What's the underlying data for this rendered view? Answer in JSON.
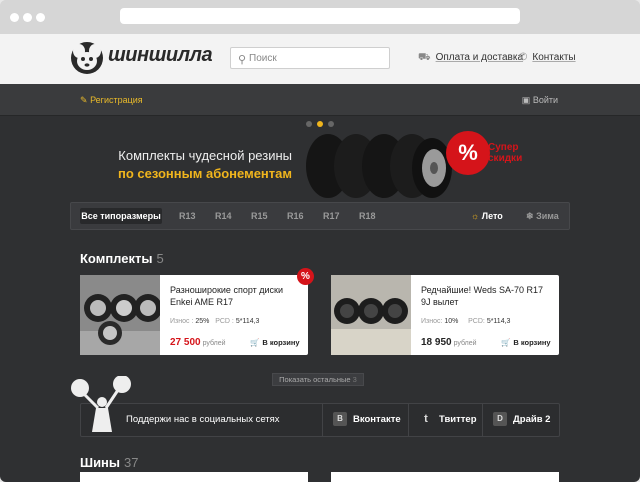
{
  "header": {
    "logo_text": "шиншилла",
    "search_placeholder": "Поиск",
    "links": [
      {
        "label": "Оплата и доставка",
        "icon": "truck-icon"
      },
      {
        "label": "Контакты",
        "icon": "phone-icon"
      }
    ]
  },
  "subbar": {
    "register_label": "Регистрация",
    "login_label": "Войти"
  },
  "promo": {
    "line1": "Комплекты чудесной резины",
    "line2": "по сезонным абонементам",
    "badge_symbol": "%",
    "badge_text_line1": "Супер",
    "badge_text_line2": "скидки"
  },
  "filter": {
    "all_label": "Все типоразмеры",
    "sizes": [
      "R13",
      "R14",
      "R15",
      "R16",
      "R17",
      "R18"
    ],
    "summer_label": "Лето",
    "winter_label": "Зима"
  },
  "sections": {
    "sets_title": "Комплекты",
    "sets_count": "5",
    "tires_title": "Шины",
    "tires_count": "37"
  },
  "cards": [
    {
      "title": "Разноширокие спорт диски Enkei AME R17",
      "wear_label": "Износ",
      "wear_value": "25%",
      "pcd_label": "PCD",
      "pcd_value": "5*114,3",
      "price": "27 500",
      "currency": "рублей",
      "cart_label": "В корзину",
      "sale_badge": "%",
      "price_color": "#d5141a"
    },
    {
      "title": "Редчайшие! Weds SA-70 R17 9J вылет",
      "wear_label": "Износ",
      "wear_value": "10%",
      "pcd_label": "PCD",
      "pcd_value": "5*114,3",
      "price": "18 950",
      "currency": "рублей",
      "cart_label": "В корзину",
      "price_color": "#222222"
    }
  ],
  "show_more": {
    "label": "Показать остальные",
    "count": "3"
  },
  "social": {
    "text": "Поддержи нас в социальных сетях",
    "buttons": [
      {
        "label": "Вконтакте",
        "icon": "vk-icon",
        "glyph": "B"
      },
      {
        "label": "Твиттер",
        "icon": "twitter-icon",
        "glyph": "t"
      },
      {
        "label": "Драйв 2",
        "icon": "drive2-icon",
        "glyph": "D"
      }
    ]
  },
  "colors": {
    "accent": "#f0b51d",
    "sale": "#d5141a",
    "dark_bg": "#2f3032"
  }
}
